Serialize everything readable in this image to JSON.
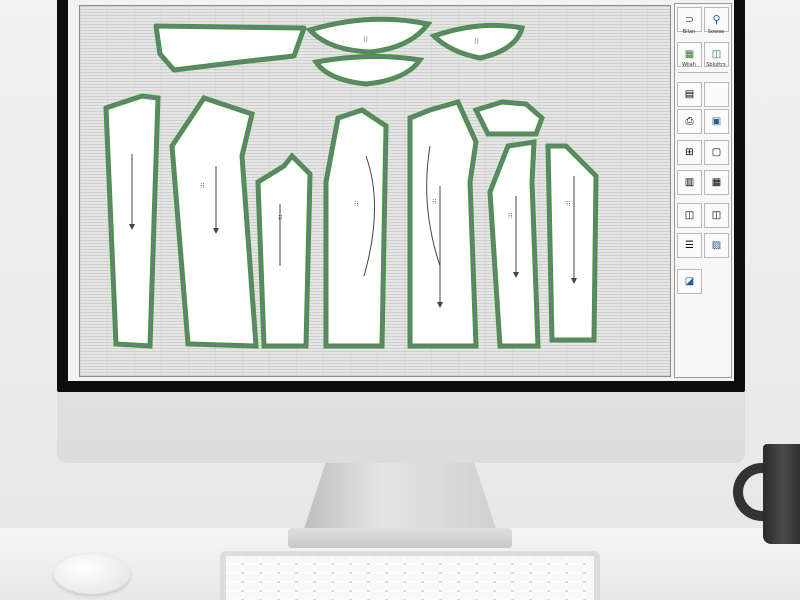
{
  "scene": "desktop computer displaying garment pattern design software",
  "toolbar": {
    "tools": [
      {
        "icon": "pattern-tool-icon",
        "label": "Bilan"
      },
      {
        "icon": "search-icon",
        "label": "Sowae"
      },
      {
        "icon": "chart-icon",
        "label": "Wiiah"
      },
      {
        "icon": "layers-icon",
        "label": "Sbluttrs"
      }
    ],
    "side_icons": [
      "document-icon",
      "blank-tool-icon",
      "print-icon",
      "window-icon",
      "measure-icon",
      "page-icon",
      "table-icon",
      "grid-icon",
      "dual-panel-icon",
      "split-view-icon",
      "list-view-icon",
      "image-icon",
      "save-icon"
    ]
  },
  "colors": {
    "pattern_seam_green": "#3f9a3f",
    "pattern_seam_purple": "#a855c8",
    "canvas_background": "#e5e5e5",
    "monitor_bezel": "#0d0d0d"
  }
}
